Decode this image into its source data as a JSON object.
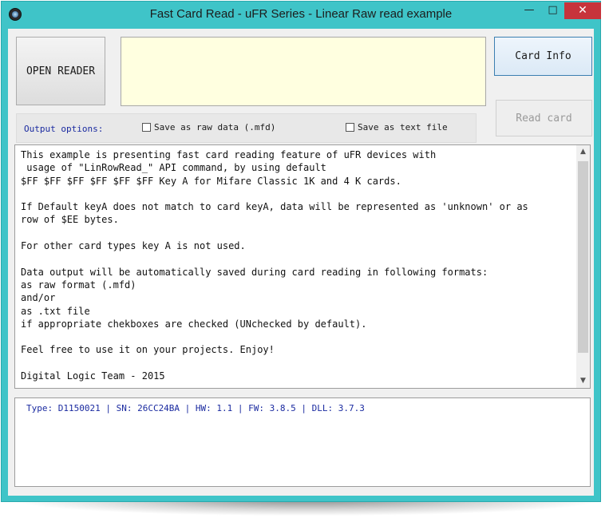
{
  "window": {
    "title": "Fast Card Read - uFR Series - Linear Raw read example",
    "min_glyph": "—",
    "max_glyph": "□",
    "close_glyph": "✕"
  },
  "buttons": {
    "open_reader": "OPEN READER",
    "card_info": "Card Info",
    "read_card": "Read card"
  },
  "options": {
    "label": "Output options:",
    "save_raw": "Save as raw data (.mfd)",
    "save_text": "Save as text file",
    "save_raw_checked": false,
    "save_text_checked": false
  },
  "description": {
    "lines": [
      "This example is presenting fast card reading feature of uFR devices with",
      " usage of \"LinRowRead_\" API command, by using default",
      "$FF $FF $FF $FF $FF $FF Key A for Mifare Classic 1K and 4 K cards.",
      "",
      "If Default keyA does not match to card keyA, data will be represented as 'unknown' or as",
      "row of $EE bytes.",
      "",
      "For other card types key A is not used.",
      "",
      "Data output will be automatically saved during card reading in following formats:",
      "as raw format (.mfd)",
      "and/or",
      "as .txt file",
      "if appropriate chekboxes are checked (UNchecked by default).",
      "",
      "Feel free to use it on your projects. Enjoy!",
      "",
      "Digital Logic Team - 2015"
    ]
  },
  "status": {
    "text": "Type: D1150021 | SN: 26CC24BA | HW: 1.1 | FW: 3.8.5 | DLL: 3.7.3"
  },
  "icons": {
    "app": "app-icon",
    "scroll_up": "▲",
    "scroll_down": "▼"
  },
  "colors": {
    "window_frame": "#3fc4c8",
    "close_button": "#c7333b",
    "yellow_panel": "#ffffe0",
    "label_blue": "#1a2aa0"
  }
}
